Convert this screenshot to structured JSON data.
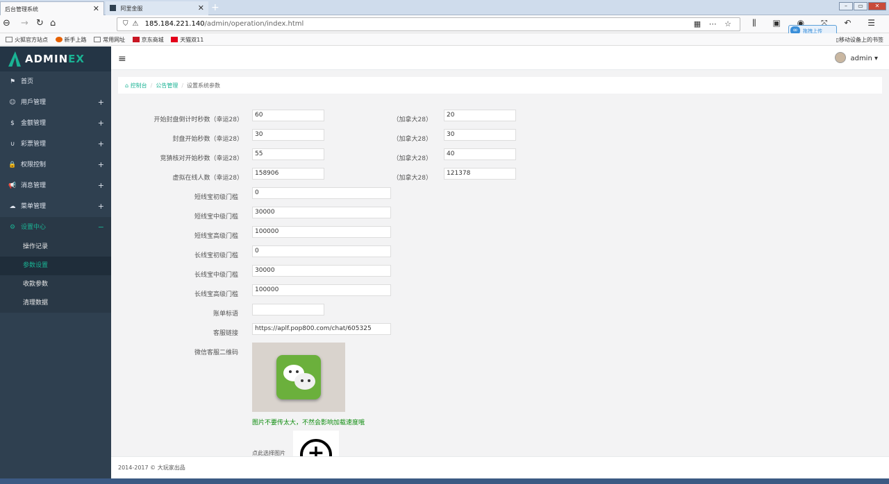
{
  "browser": {
    "tabs": [
      {
        "label": "后台管理系统",
        "close": "✕"
      },
      {
        "label": "阿里金服",
        "close": "✕"
      }
    ],
    "new_tab": "+",
    "url_host": "185.184.221.140",
    "url_path": "/admin/operation/index.html",
    "url_actions": "▦ ⋯ ☆",
    "toolbar_icons": "⫼ ▣ ◉ ⤧ ↶ ☰",
    "baidu_label": "拖拽上传",
    "bookmarks": [
      "火狐官方站点",
      "新手上路",
      "常用网址",
      "京东商城",
      "天猫双11"
    ],
    "mobile_bookmarks": "移动设备上的书签"
  },
  "brand": {
    "name_main": "ADMIN",
    "name_accent": "EX"
  },
  "sidebar": {
    "items": [
      {
        "icon": "⚑",
        "label": "首页",
        "plus": ""
      },
      {
        "icon": "☺",
        "label": "用戶管理",
        "plus": "+"
      },
      {
        "icon": "$",
        "label": "金额管理",
        "plus": "+"
      },
      {
        "icon": "∪",
        "label": "彩票管理",
        "plus": "+"
      },
      {
        "icon": "🔒",
        "label": "权限控制",
        "plus": "+"
      },
      {
        "icon": "📢",
        "label": "消息管理",
        "plus": "+"
      },
      {
        "icon": "☁",
        "label": "菜单管理",
        "plus": "+"
      },
      {
        "icon": "⚙",
        "label": "设置中心",
        "plus": "−"
      }
    ],
    "subitems": [
      "操作记录",
      "参数设置",
      "收款参数",
      "清理数据"
    ]
  },
  "topbar": {
    "menu_icon": "≡",
    "user": "admin ▾"
  },
  "breadcrumb": {
    "home": "控制台",
    "level2": "公告管理",
    "current": "设置系统参数",
    "sep": "/"
  },
  "form": {
    "row_labels": [
      "开始封盘倒计时秒数（幸运28）",
      "封盘开始秒数（幸运28）",
      "竞猜核对开始秒数（幸运28）",
      "虚拟在线人数（幸运28）"
    ],
    "row_values": [
      "60",
      "30",
      "55",
      "158906"
    ],
    "canada_label": "（加拿大28）",
    "canada_values": [
      "20",
      "30",
      "40",
      "121378"
    ],
    "tier_labels": [
      "短线宝初级门槛",
      "短线宝中级门槛",
      "短线宝高级门槛",
      "长线宝初级门槛",
      "长线宝中级门槛",
      "长线宝高级门槛"
    ],
    "tier_values": [
      "0",
      "30000",
      "100000",
      "0",
      "30000",
      "100000"
    ],
    "bill_label": "账单标语",
    "bill_value": "",
    "service_label": "客服链接",
    "service_value": "https://aplf.pop800.com/chat/605325",
    "wechat_label": "微信客服二维码",
    "image_hint": "图片不要传太大，不然会影响加载速度哦",
    "upload_label": "点此选择图片",
    "upload_icon": "+"
  },
  "footer": {
    "copyright": "2014-2017 © 大玩家出品"
  },
  "colors": {
    "sidebar": "#2f4050",
    "accent": "#1ab394",
    "content_bg": "#f3f3f4"
  }
}
